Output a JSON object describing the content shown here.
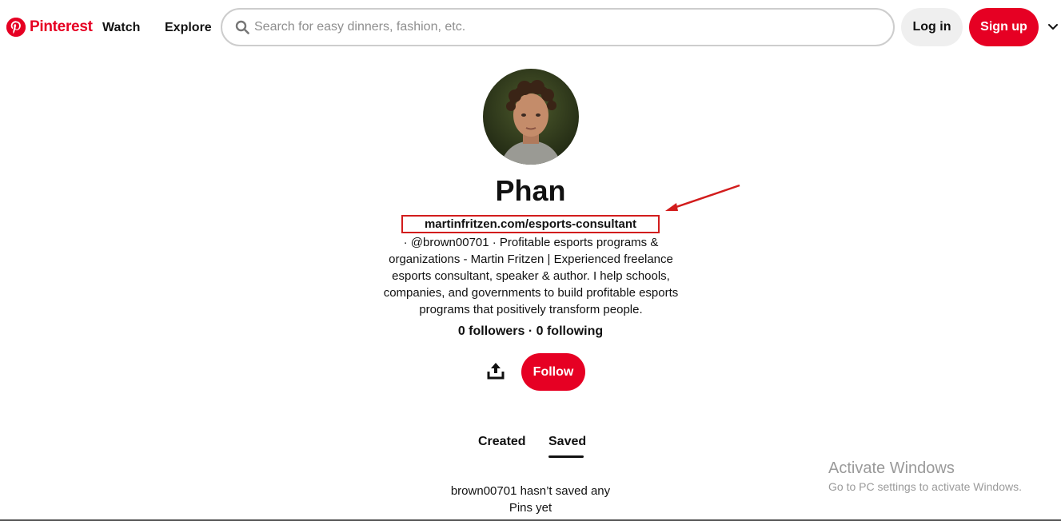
{
  "header": {
    "brand": "Pinterest",
    "nav": {
      "watch": "Watch",
      "explore": "Explore"
    },
    "search": {
      "placeholder": "Search for easy dinners, fashion, etc.",
      "value": ""
    },
    "login_label": "Log in",
    "signup_label": "Sign up"
  },
  "profile": {
    "name": "Phan",
    "website": "martinfritzen.com/esports-consultant",
    "bio_lines": [
      "· @brown00701 · Profitable esports programs &",
      "organizations - Martin Fritzen | Experienced freelance",
      "esports consultant, speaker & author. I help schools,",
      "companies, and governments to build profitable esports",
      "programs that positively transform people."
    ],
    "stats": "0 followers · 0 following",
    "follow_label": "Follow"
  },
  "tabs": {
    "created": "Created",
    "saved": "Saved",
    "active": "Saved"
  },
  "empty_state": {
    "line1": "brown00701 hasn’t saved any",
    "line2": "Pins yet"
  },
  "watermark": {
    "title": "Activate Windows",
    "subtitle": "Go to PC settings to activate Windows."
  },
  "colors": {
    "brand": "#e60023",
    "annotation": "#d21c1c"
  },
  "icons": [
    "pinterest-logo-icon",
    "search-icon",
    "chevron-down-icon",
    "share-icon",
    "annotation-arrow-icon"
  ]
}
